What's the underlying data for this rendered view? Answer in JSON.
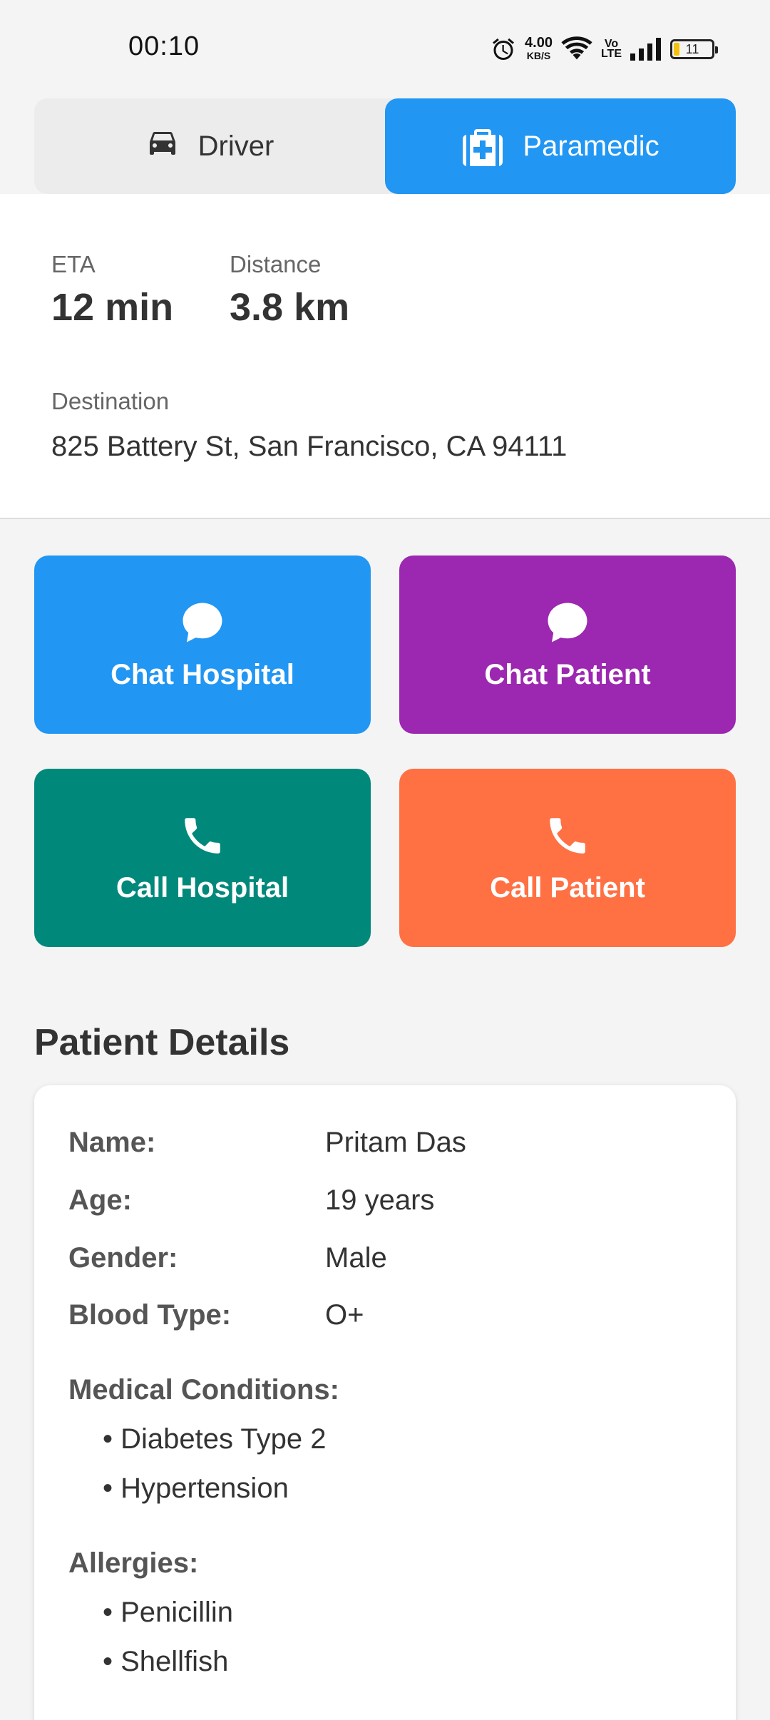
{
  "status_bar": {
    "time": "00:10",
    "net_speed_value": "4.00",
    "net_speed_unit": "KB/S",
    "volte_top": "Vo",
    "volte_bottom": "LTE",
    "battery": "11",
    "icons": [
      "alarm-icon",
      "wifi-icon",
      "volte-icon",
      "signal-icon",
      "battery-icon"
    ]
  },
  "mode_toggle": {
    "tabs": [
      {
        "label": "Driver",
        "icon": "car-icon",
        "active": false
      },
      {
        "label": "Paramedic",
        "icon": "medical-kit-icon",
        "active": true
      }
    ]
  },
  "trip": {
    "eta_label": "ETA",
    "eta_value": "12 min",
    "distance_label": "Distance",
    "distance_value": "3.8 km",
    "destination_label": "Destination",
    "destination_value": "825 Battery St, San Francisco, CA 94111"
  },
  "actions": [
    {
      "label": "Chat Hospital",
      "icon": "chat-icon",
      "color": "#2196f3"
    },
    {
      "label": "Chat Patient",
      "icon": "chat-icon",
      "color": "#9c27b0"
    },
    {
      "label": "Call Hospital",
      "icon": "phone-icon",
      "color": "#00897b"
    },
    {
      "label": "Call Patient",
      "icon": "phone-icon",
      "color": "#ff7043"
    }
  ],
  "patient": {
    "section_title": "Patient Details",
    "fields": [
      {
        "label": "Name:",
        "value": "Pritam Das"
      },
      {
        "label": "Age:",
        "value": "19 years"
      },
      {
        "label": "Gender:",
        "value": "Male"
      },
      {
        "label": "Blood Type:",
        "value": "O+"
      }
    ],
    "conditions_title": "Medical Conditions:",
    "conditions": [
      "Diabetes Type 2",
      "Hypertension"
    ],
    "allergies_title": "Allergies:",
    "allergies": [
      "Penicillin",
      "Shellfish"
    ]
  }
}
